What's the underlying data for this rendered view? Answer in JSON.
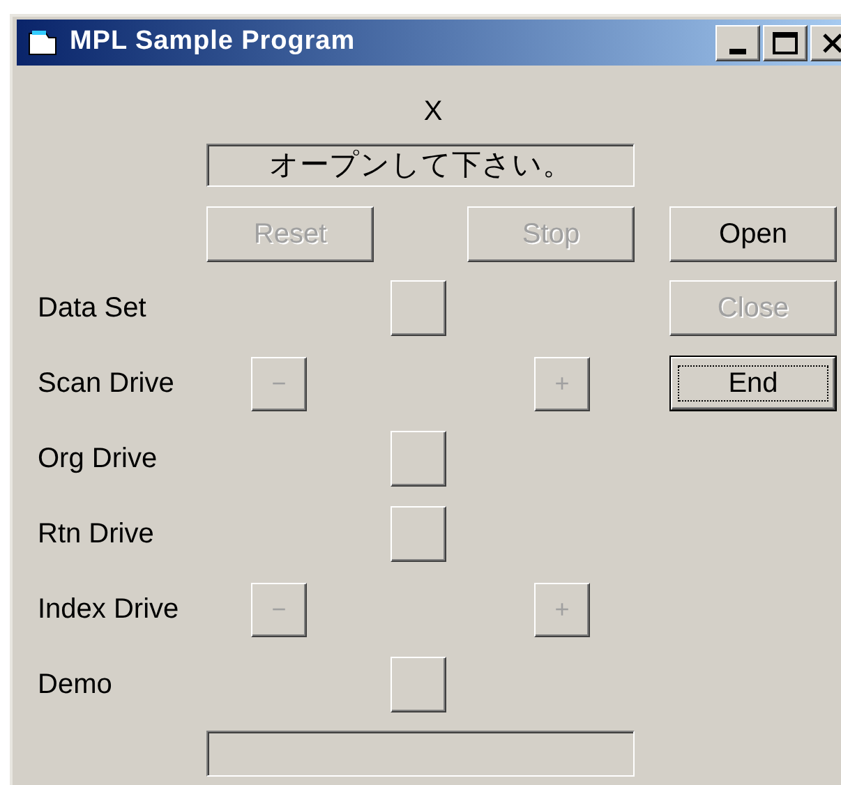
{
  "window": {
    "title": "MPL Sample Program"
  },
  "caption": "X",
  "status": {
    "value": "オープンして下さい。"
  },
  "top_buttons": [
    {
      "label": "Reset",
      "disabled": true
    },
    {
      "label": "Stop",
      "disabled": true
    }
  ],
  "side_buttons": [
    {
      "label": "Open",
      "disabled": false,
      "focused": false
    },
    {
      "label": "Close",
      "disabled": true,
      "focused": false
    },
    {
      "label": "End",
      "disabled": false,
      "focused": true
    }
  ],
  "rows": [
    {
      "kind": "toggle",
      "label": "Data Set"
    },
    {
      "kind": "stepper",
      "label": "Scan Drive",
      "minus": "−",
      "plus": "+",
      "disabled": true
    },
    {
      "kind": "toggle",
      "label": "Org Drive"
    },
    {
      "kind": "toggle",
      "label": "Rtn Drive"
    },
    {
      "kind": "stepper",
      "label": "Index Drive",
      "minus": "−",
      "plus": "+",
      "disabled": true
    },
    {
      "kind": "toggle",
      "label": "Demo"
    }
  ]
}
